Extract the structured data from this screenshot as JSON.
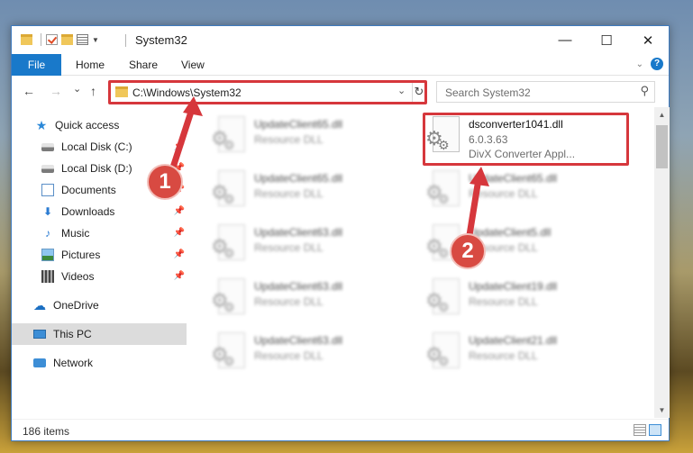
{
  "window": {
    "title": "System32",
    "controls": {
      "minimize": "—",
      "maximize": "☐",
      "close": "✕"
    }
  },
  "ribbon": {
    "tabs": [
      "File",
      "Home",
      "Share",
      "View"
    ]
  },
  "nav": {
    "back": "←",
    "forward": "→",
    "recent": "⌄",
    "up": "↑",
    "address": "C:\\Windows\\System32",
    "search_placeholder": "Search System32"
  },
  "sidebar": {
    "items": [
      {
        "label": "Quick access",
        "icon": "star-icon",
        "pinned": false
      },
      {
        "label": "Local Disk (C:)",
        "icon": "disk-icon",
        "pinned": true
      },
      {
        "label": "Local Disk (D:)",
        "icon": "disk-icon",
        "pinned": true
      },
      {
        "label": "Documents",
        "icon": "documents-icon",
        "pinned": true
      },
      {
        "label": "Downloads",
        "icon": "downloads-icon",
        "pinned": true
      },
      {
        "label": "Music",
        "icon": "music-icon",
        "pinned": true
      },
      {
        "label": "Pictures",
        "icon": "pictures-icon",
        "pinned": true
      },
      {
        "label": "Videos",
        "icon": "videos-icon",
        "pinned": true
      },
      {
        "label": "OneDrive",
        "icon": "onedrive-icon",
        "pinned": false
      },
      {
        "label": "This PC",
        "icon": "this-pc-icon",
        "pinned": false,
        "selected": true
      },
      {
        "label": "Network",
        "icon": "network-icon",
        "pinned": false
      }
    ]
  },
  "files": [
    {
      "name": "UpdateClient65.dll",
      "line1": "Resource DLL",
      "line2": ""
    },
    {
      "name": "dsconverter1041.dll",
      "line1": "6.0.3.63",
      "line2": "DivX Converter Appl..."
    },
    {
      "name": "UpdateClient65.dll",
      "line1": "Resource DLL",
      "line2": ""
    },
    {
      "name": "UpdateClient65.dll",
      "line1": "Resource DLL",
      "line2": ""
    },
    {
      "name": "UpdateClient63.dll",
      "line1": "Resource DLL",
      "line2": ""
    },
    {
      "name": "UpdateClient5.dll",
      "line1": "Resource DLL",
      "line2": ""
    },
    {
      "name": "UpdateClient63.dll",
      "line1": "Resource DLL",
      "line2": ""
    },
    {
      "name": "UpdateClient19.dll",
      "line1": "Resource DLL",
      "line2": ""
    },
    {
      "name": "UpdateClient63.dll",
      "line1": "Resource DLL",
      "line2": ""
    },
    {
      "name": "UpdateClient21.dll",
      "line1": "Resource DLL",
      "line2": ""
    }
  ],
  "status": {
    "item_count": "186 items"
  },
  "annotations": {
    "badge1": "1",
    "badge2": "2",
    "highlight_color": "#d6373c"
  }
}
